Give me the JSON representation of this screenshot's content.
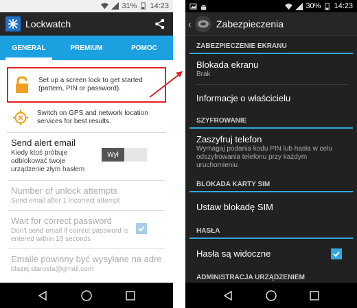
{
  "left": {
    "status": {
      "battery_pct": "31%",
      "time": "14:23"
    },
    "app_title": "Lockwatch",
    "tabs": [
      "GENERAL",
      "PREMIUM",
      "POMOC"
    ],
    "cards": [
      {
        "text": "Set up a screen lock to get started (pattern, PIN or password)."
      },
      {
        "text": "Switch on GPS and network location services for best results."
      }
    ],
    "prefs": {
      "send_alert": {
        "title": "Send alert email",
        "summary": "Kiedy ktoś próbuje odblokować twoje urządzenie złym hasłem",
        "toggle_label": "Wył"
      },
      "unlock_attempts": {
        "title": "Number of unlock attempts",
        "summary": "Send email after 1 incorrect attempt"
      },
      "wait_password": {
        "title": "Wait for correct password",
        "summary": "Don't send email if correct password is entered within 10 seconds"
      },
      "emails": {
        "title": "Emaile powinny być wysyłane na adre",
        "summary": "blazej.starosta@gmail.com"
      }
    }
  },
  "right": {
    "status": {
      "battery_pct": "30%",
      "time": "14:23"
    },
    "title": "Zabezpieczenia",
    "sections": {
      "screen": "ZABEZPIECZENIE EKRANU",
      "encryption": "SZYFROWANIE",
      "sim": "BLOKADA KARTY SIM",
      "passwords": "HASŁA",
      "admin": "ADMINISTRACJA URZĄDZENIEM"
    },
    "items": {
      "screen_lock": {
        "title": "Blokada ekranu",
        "summary": "Brak"
      },
      "owner_info": {
        "title": "Informacje o właścicielu"
      },
      "encrypt_phone": {
        "title": "Zaszyfruj telefon",
        "summary": "Wymagaj podania kodu PIN lub hasła w celu odszyfrowania telefonu przy każdym uruchomieniu"
      },
      "sim_lock": {
        "title": "Ustaw blokadę SIM"
      },
      "passwords_visible": {
        "title": "Hasła są widoczne"
      }
    }
  },
  "colors": {
    "tab_bar": "#1ca1e0",
    "highlight_border": "#e22222",
    "section_line": "#33a8e0"
  }
}
